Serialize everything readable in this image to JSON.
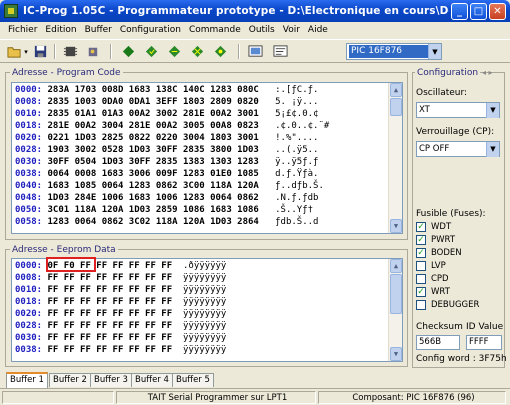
{
  "window": {
    "title": "IC-Prog 1.05C - Programmateur prototype - D:\\Electronique en cours\\Decodage IR V..."
  },
  "menu": [
    "Fichier",
    "Edition",
    "Buffer",
    "Configuration",
    "Commande",
    "Outils",
    "Voir",
    "Aide"
  ],
  "toolbar": {
    "device": "PIC 16F876"
  },
  "program_code": {
    "label": "Adresse - Program Code",
    "rows": [
      {
        "addr": "0000:",
        "hex": "283A 1703 008D 1683 138C 140C 1283 080C",
        "ascii": " :.[ƒC.ƒ."
      },
      {
        "addr": "0008:",
        "hex": "2835 1003 0DA0 0DA1 3EFF 1803 2809 0820",
        "ascii": " 5. ¡ÿ..."
      },
      {
        "addr": "0010:",
        "hex": "2835 01A1 01A3 00A2 3002 281E 00A2 3001",
        "ascii": " 5¡£¢.0.¢"
      },
      {
        "addr": "0018:",
        "hex": "281E 00A2 3004 281E 00A2 3005 00A8 0823",
        "ascii": " .¢.0..¢.¨#"
      },
      {
        "addr": "0020:",
        "hex": "0221 1D03 2825 0822 0220 3004 1803 3001",
        "ascii": " !.%\"...."
      },
      {
        "addr": "0028:",
        "hex": "1903 3002 0528 1D03 30FF 2835 3800 1D03",
        "ascii": " ..(.ÿ5.."
      },
      {
        "addr": "0030:",
        "hex": "30FF 0504 1D03 30FF 2835 1383 1303 1283",
        "ascii": " ÿ..ÿ5ƒ.ƒ"
      },
      {
        "addr": "0038:",
        "hex": "0064 0008 1683 3006 009F 1283 01E0 1085",
        "ascii": " d.ƒ.Ÿƒà."
      },
      {
        "addr": "0040:",
        "hex": "1683 1085 0064 1283 0862 3C00 118A 120A",
        "ascii": " ƒ..dƒb.Š."
      },
      {
        "addr": "0048:",
        "hex": "1D03 284E 1006 1683 1006 1283 0064 0862",
        "ascii": " .N.ƒ.ƒdb"
      },
      {
        "addr": "0050:",
        "hex": "3C01 118A 120A 1D03 2859 1086 1683 1086",
        "ascii": " .Š..Yƒ†"
      },
      {
        "addr": "0058:",
        "hex": "1283 0064 0862 3C02 118A 120A 1D03 2864",
        "ascii": " ƒdb.Š..d"
      }
    ]
  },
  "eeprom": {
    "label": "Adresse - Eeprom Data",
    "rows": [
      {
        "addr": "0000:",
        "hex": "0F F0 FF FF FF FF FF FF",
        "ascii": ".ðÿÿÿÿÿÿ"
      },
      {
        "addr": "0008:",
        "hex": "FF FF FF FF FF FF FF FF",
        "ascii": "ÿÿÿÿÿÿÿÿ"
      },
      {
        "addr": "0010:",
        "hex": "FF FF FF FF FF FF FF FF",
        "ascii": "ÿÿÿÿÿÿÿÿ"
      },
      {
        "addr": "0018:",
        "hex": "FF FF FF FF FF FF FF FF",
        "ascii": "ÿÿÿÿÿÿÿÿ"
      },
      {
        "addr": "0020:",
        "hex": "FF FF FF FF FF FF FF FF",
        "ascii": "ÿÿÿÿÿÿÿÿ"
      },
      {
        "addr": "0028:",
        "hex": "FF FF FF FF FF FF FF FF",
        "ascii": "ÿÿÿÿÿÿÿÿ"
      },
      {
        "addr": "0030:",
        "hex": "FF FF FF FF FF FF FF FF",
        "ascii": "ÿÿÿÿÿÿÿÿ"
      },
      {
        "addr": "0038:",
        "hex": "FF FF FF FF FF FF FF FF",
        "ascii": "ÿÿÿÿÿÿÿÿ"
      }
    ]
  },
  "config": {
    "title": "Configuration",
    "oscillator_label": "Oscillateur:",
    "oscillator_value": "XT",
    "lock_label": "Verrouillage (CP):",
    "lock_value": "CP OFF",
    "fuses_label": "Fusible (Fuses):",
    "fuses": [
      {
        "name": "WDT",
        "checked": "✓"
      },
      {
        "name": "PWRT",
        "checked": "✓"
      },
      {
        "name": "BODEN",
        "checked": "✓"
      },
      {
        "name": "LVP",
        "checked": ""
      },
      {
        "name": "CPD",
        "checked": ""
      },
      {
        "name": "WRT",
        "checked": "✓"
      },
      {
        "name": "DEBUGGER",
        "checked": ""
      }
    ],
    "checksum_label": "Checksum",
    "checksum_value": "566B",
    "id_label": "ID Value",
    "id_value": "FFFF",
    "config_word": "Config word : 3F75h"
  },
  "tabs": [
    "Buffer 1",
    "Buffer 2",
    "Buffer 3",
    "Buffer 4",
    "Buffer 5"
  ],
  "status": {
    "programmer": "TAIT Serial Programmer sur LPT1",
    "component": "Composant: PIC 16F876   (96)"
  }
}
